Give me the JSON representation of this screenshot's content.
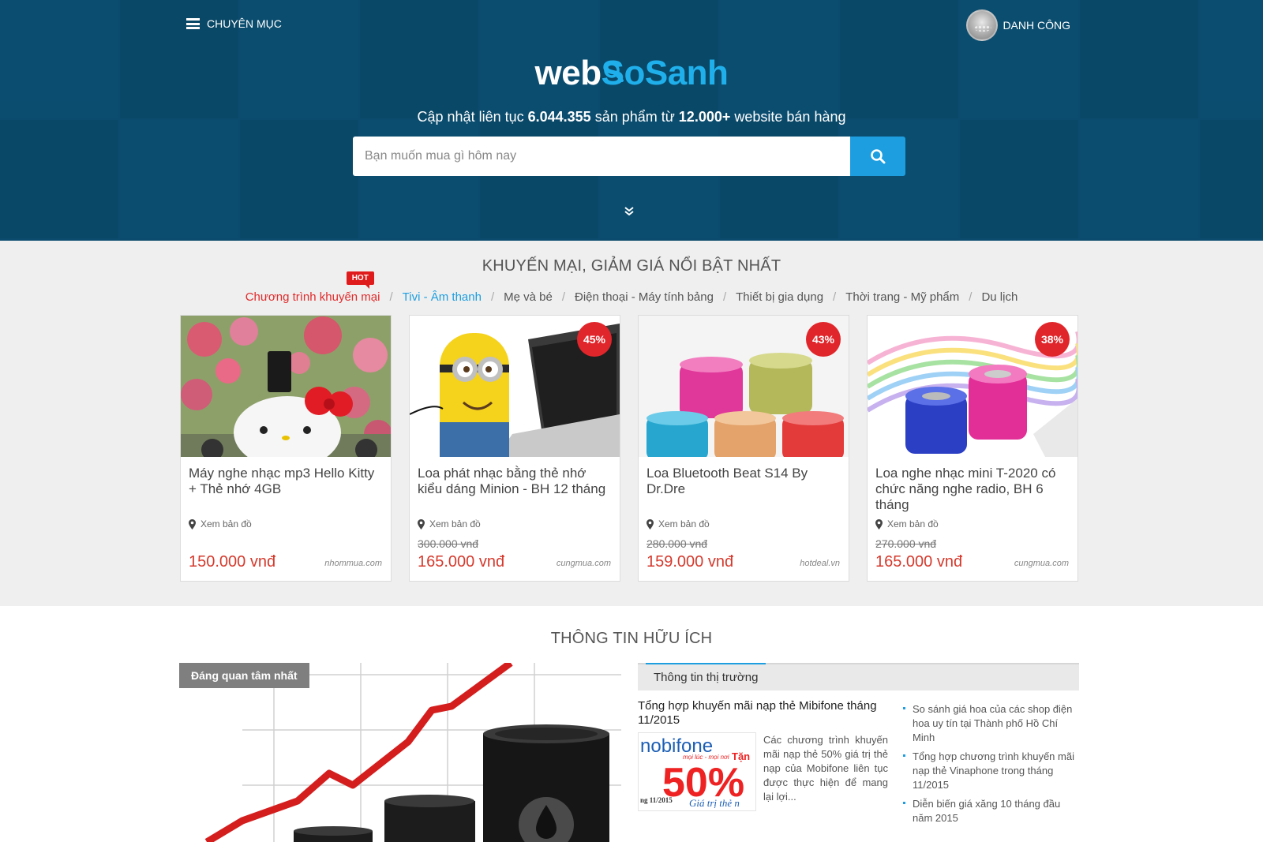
{
  "header": {
    "menu_label": "CHUYÊN MỤC",
    "user_name": "DANH CÔNG",
    "logo_web": "web",
    "logo_so": "So",
    "logo_sanh": "Sanh",
    "tagline_pre": "Cập nhật liên tục ",
    "product_count": "6.044.355",
    "tagline_mid": " sản phẩm từ ",
    "website_count": "12.000+",
    "tagline_post": " website bán hàng",
    "search_placeholder": "Bạn muốn mua gì hôm nay"
  },
  "promo": {
    "title": "KHUYẾN MẠI, GIẢM GIÁ NỔI BẬT NHẤT",
    "hot_label": "HOT",
    "categories": [
      "Chương trình khuyến mại",
      "Tivi - Âm thanh",
      "Mẹ và bé",
      "Điện thoại - Máy tính bảng",
      "Thiết bị gia dụng",
      "Thời trang - Mỹ phẩm",
      "Du lịch"
    ],
    "separator": "/",
    "map_label": "Xem bản đồ",
    "products": [
      {
        "name": "Máy nghe nhạc mp3 Hello Kitty + Thẻ nhớ 4GB",
        "price": "150.000 vnđ",
        "old_price": "",
        "discount": "",
        "source": "nhommua.com"
      },
      {
        "name": "Loa phát nhạc bằng thẻ nhớ kiểu dáng Minion - BH 12 tháng",
        "price": "165.000 vnđ",
        "old_price": "300.000 vnđ",
        "discount": "45%",
        "source": "cungmua.com"
      },
      {
        "name": "Loa Bluetooth Beat S14 By Dr.Dre",
        "price": "159.000 vnđ",
        "old_price": "280.000 vnđ",
        "discount": "43%",
        "source": "hotdeal.vn"
      },
      {
        "name": "Loa nghe nhạc mini T-2020 có chức năng nghe radio, BH 6 tháng",
        "price": "165.000 vnđ",
        "old_price": "270.000 vnđ",
        "discount": "38%",
        "source": "cungmua.com"
      }
    ]
  },
  "info": {
    "title": "THÔNG TIN HỮU ÍCH",
    "feature_tag": "Đáng quan tâm nhất",
    "tab_label": "Thông tin thị trường",
    "article_title": "Tổng hợp khuyến mãi nạp thẻ Mibifone tháng 11/2015",
    "article_desc": "Các chương trình khuyến mãi nạp thẻ 50% giá trị thẻ nạp của Mobifone liên tục được thực hiện để mang lại lợi...",
    "ad_brand": "nobifone",
    "ad_slogan": "mọi lúc - mọi nơi",
    "ad_percent": "50%",
    "ad_tang": "Tặn",
    "ad_date": "ng 11/2015",
    "ad_caption": "Giá trị thẻ n",
    "links": [
      "So sánh giá hoa của các shop điện hoa uy tín tại Thành phố Hồ Chí Minh",
      "Tổng hợp chương trình khuyến mãi nạp thẻ Vinaphone trong tháng 11/2015",
      "Diễn biến giá xăng 10 tháng đầu năm 2015"
    ]
  },
  "colors": {
    "hero_bg": "#0e5173",
    "accent_blue": "#1d9ee0",
    "price_red": "#d5392c",
    "hot_red": "#e01b1b"
  }
}
